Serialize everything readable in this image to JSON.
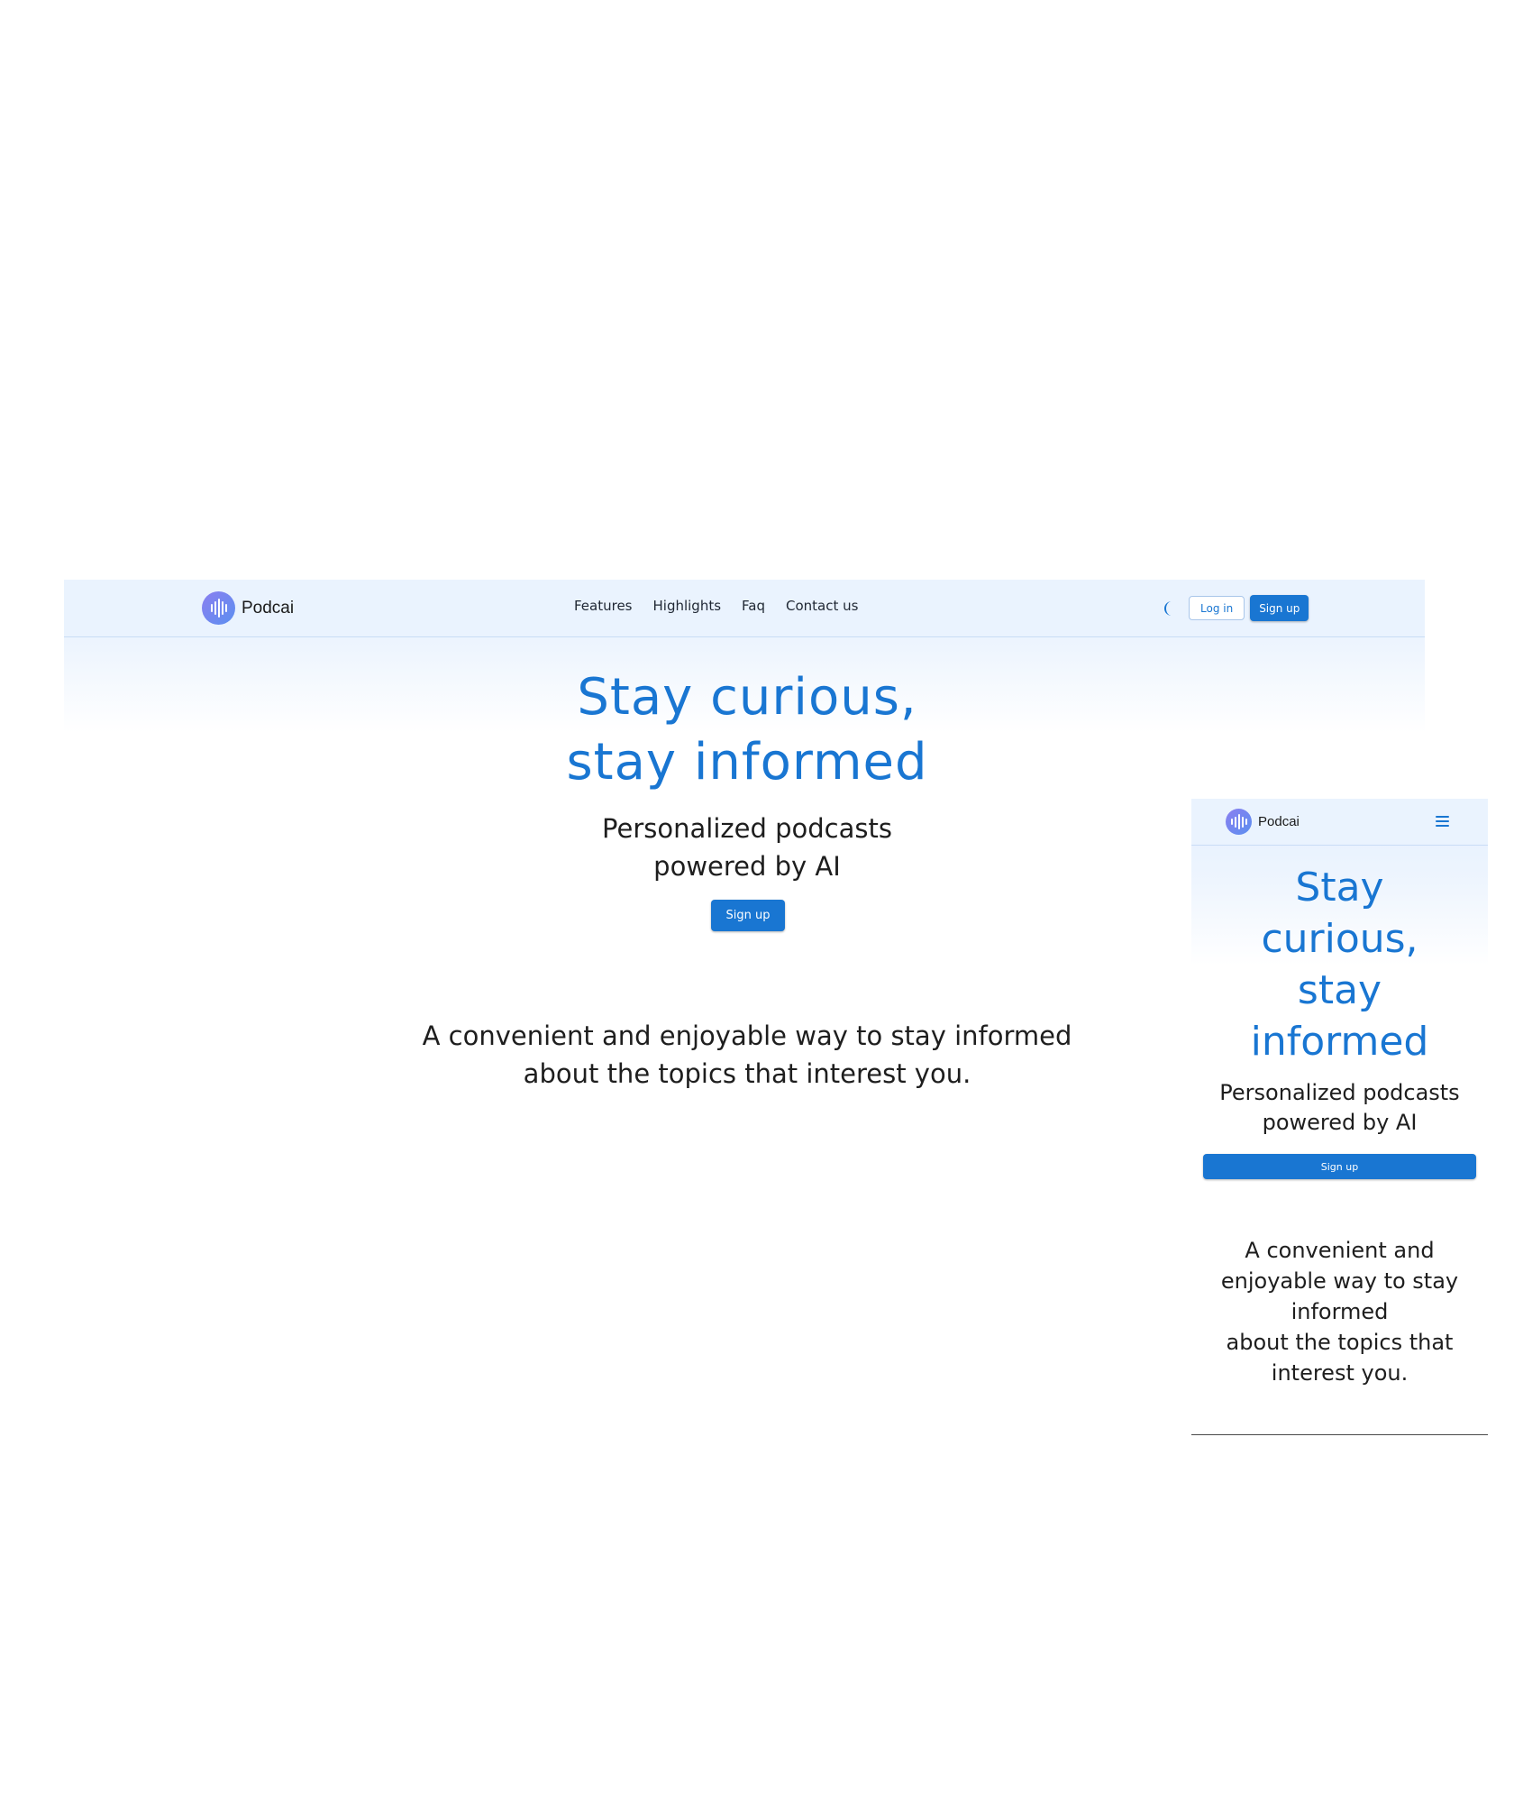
{
  "brand": {
    "name": "Podcai",
    "logo_icon": "soundwave-icon",
    "logo_gradient": [
      "#8b7ff0",
      "#5b8ff0"
    ]
  },
  "colors": {
    "accent": "#1976d2",
    "nav_background": "#eaf3fe",
    "text": "#1e1e1e"
  },
  "desktop": {
    "nav": {
      "links": [
        "Features",
        "Highlights",
        "Faq",
        "Contact us"
      ],
      "theme_toggle_icon": "moon-icon",
      "login_label": "Log in",
      "signup_label": "Sign up"
    },
    "hero": {
      "title_line1": "Stay curious,",
      "title_line2": "stay informed",
      "subtitle_line1": "Personalized podcasts",
      "subtitle_line2": "powered by AI",
      "cta_label": "Sign up",
      "description_line1": "A convenient and enjoyable way to stay informed",
      "description_line2": "about the topics that interest you."
    }
  },
  "mobile": {
    "nav": {
      "menu_icon": "hamburger-menu-icon"
    },
    "hero": {
      "title_lines": [
        "Stay",
        "curious,",
        "stay",
        "informed"
      ],
      "subtitle_line1": "Personalized podcasts",
      "subtitle_line2": "powered by AI",
      "cta_label": "Sign up",
      "description_lines": [
        "A convenient and",
        "enjoyable way to stay",
        "informed",
        "about the topics that",
        "interest you."
      ]
    }
  }
}
